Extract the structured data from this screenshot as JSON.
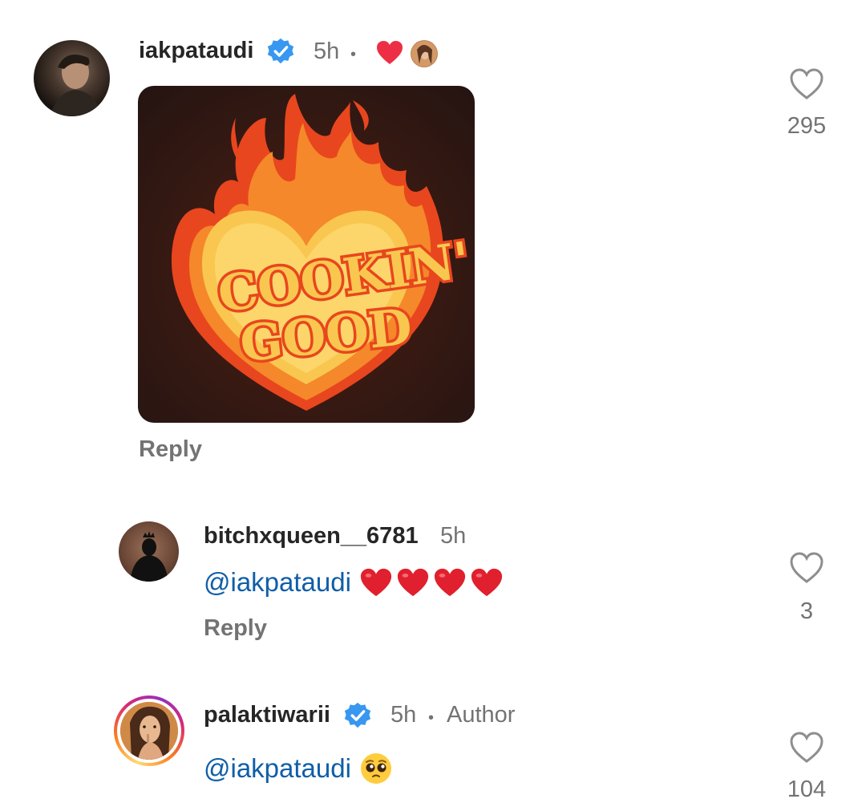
{
  "comments": [
    {
      "username": "iakpataudi",
      "verified": true,
      "time": "5h",
      "sticker_text": [
        "COOKIN'",
        "GOOD"
      ],
      "reply_label": "Reply",
      "likes": "295"
    },
    {
      "username": "bitchxqueen__6781",
      "verified": false,
      "time": "5h",
      "mention": "@iakpataudi",
      "emojis": "heart-emoji x4",
      "reply_label": "Reply",
      "likes": "3"
    },
    {
      "username": "palaktiwarii",
      "verified": true,
      "time": "5h",
      "author_tag": "Author",
      "mention": "@iakpataudi",
      "emojis": "pleading-face-emoji",
      "likes": "104"
    }
  ],
  "colors": {
    "heart_red": "#ed2f45",
    "verified_blue": "#3897f0",
    "mention_blue": "#0f5ea8",
    "meta_gray": "#737373"
  }
}
